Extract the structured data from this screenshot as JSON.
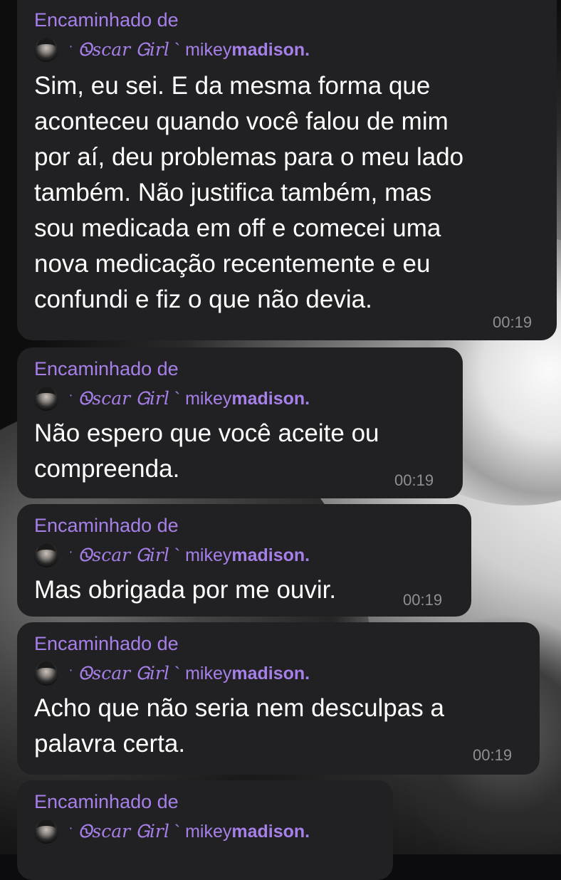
{
  "forward_label": "Encaminhado de",
  "sender": {
    "prefix": "ˑ",
    "fancy_name": "Ꮻscar Ꮐirl",
    "separator": "`",
    "handle_start": "mikey",
    "handle_bold": "madison."
  },
  "messages": [
    {
      "text": "Sim, eu sei. E da mesma forma que\naconteceu quando você falou de mim\npor aí, deu problemas para o meu lado\ntambém. Não justifica também, mas\nsou medicada em off e comecei uma\nnova medicação recentemente e eu\nconfundi e fiz o que não devia.",
      "time": "00:19"
    },
    {
      "text": "Não espero que você aceite ou\ncompreenda.",
      "time": "00:19"
    },
    {
      "text": "Mas obrigada por me ouvir.",
      "time": "00:19"
    },
    {
      "text": "Acho que não seria nem desculpas a\npalavra certa.",
      "time": "00:19"
    },
    {
      "text": "",
      "time": ""
    }
  ],
  "colors": {
    "bubble": "#212124",
    "accent": "#a680e8",
    "text": "#ffffff",
    "time": "#8e8e93"
  }
}
